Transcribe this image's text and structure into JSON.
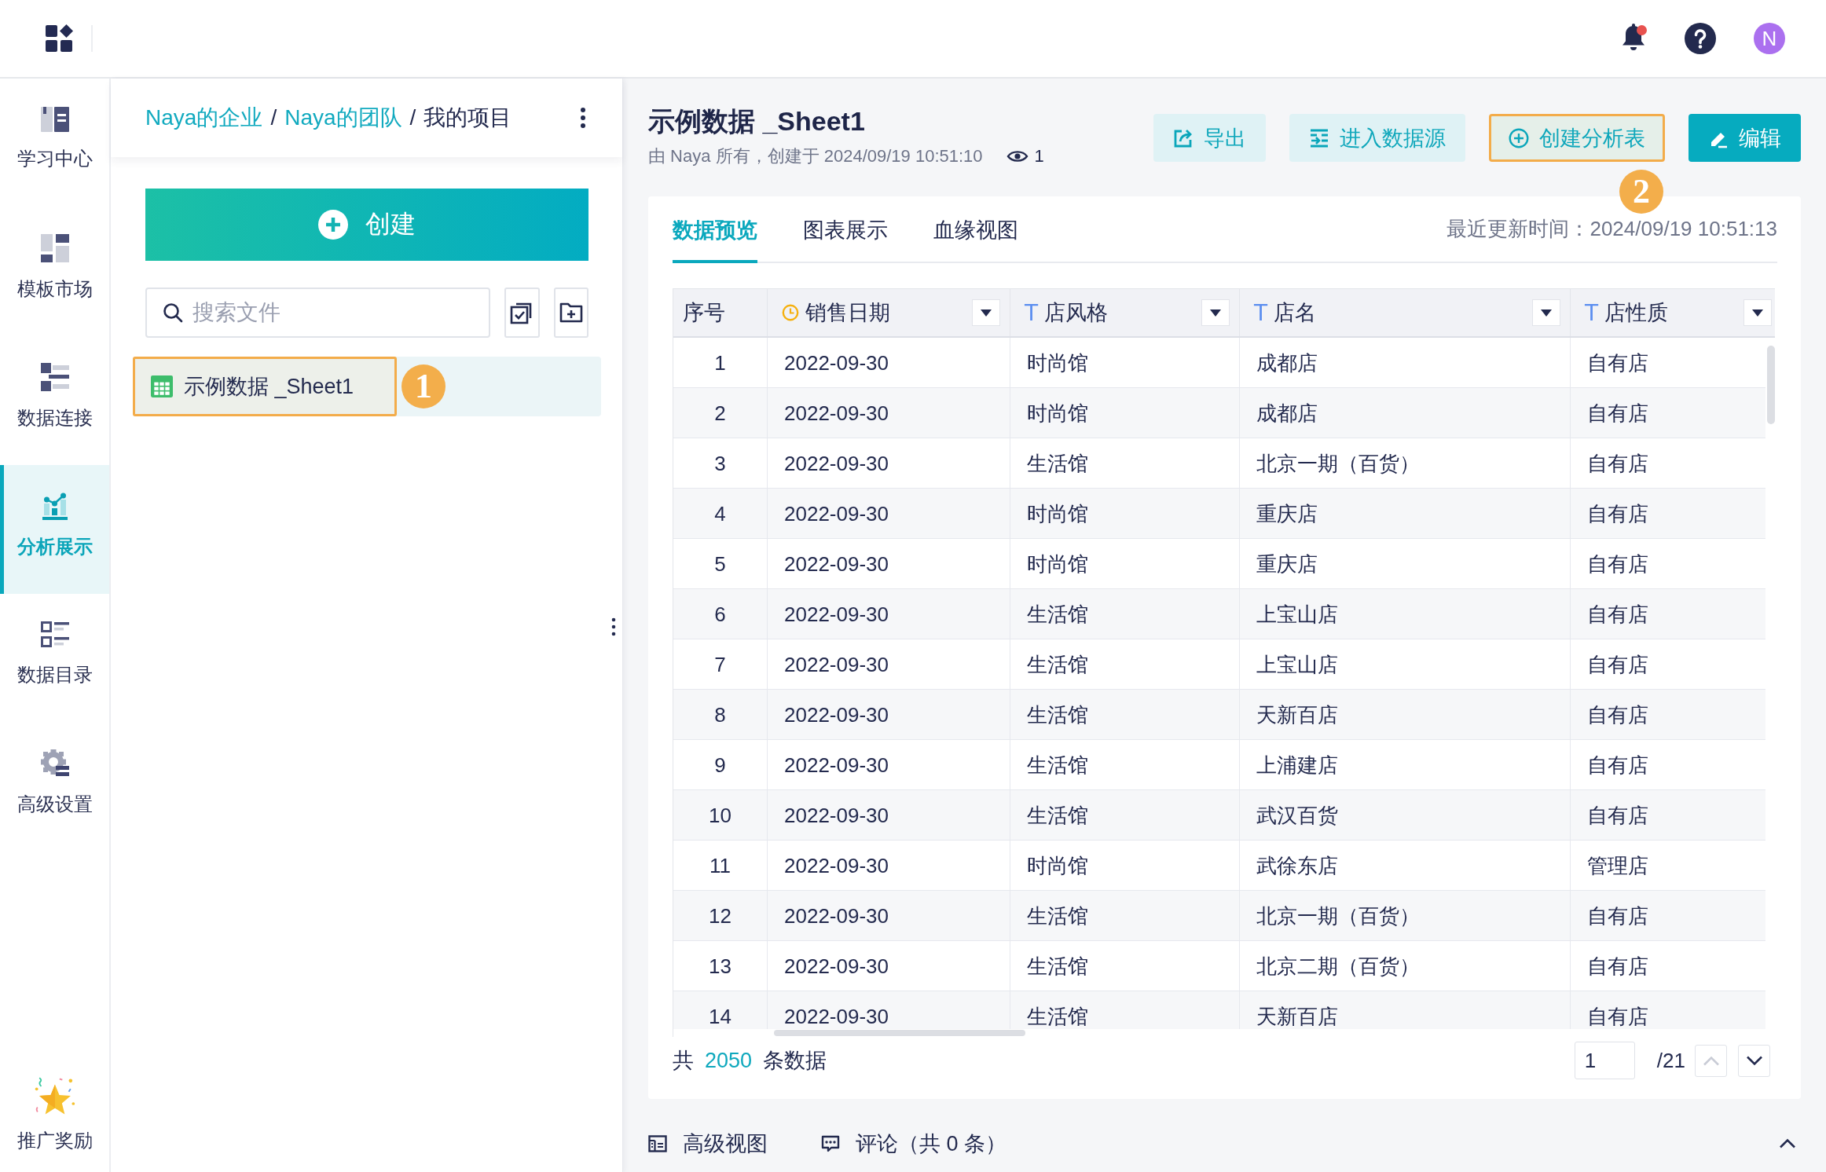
{
  "top_bar": {
    "notifications": {
      "unread": true
    },
    "avatar": {
      "initial": "N"
    }
  },
  "nav": {
    "items": [
      {
        "label": "学习中心",
        "kind": "learning",
        "selected": false
      },
      {
        "label": "模板市场",
        "kind": "templates",
        "selected": false
      },
      {
        "label": "数据连接",
        "kind": "connections",
        "selected": false
      },
      {
        "label": "分析展示",
        "kind": "analysis",
        "selected": true
      },
      {
        "label": "数据目录",
        "kind": "catalog",
        "selected": false
      },
      {
        "label": "高级设置",
        "kind": "settings",
        "selected": false
      }
    ],
    "footer_item": {
      "label": "推广奖励"
    }
  },
  "file_panel": {
    "breadcrumb": [
      {
        "label": "Naya的企业",
        "kind": "link"
      },
      {
        "label": "/",
        "kind": "separator"
      },
      {
        "label": "Naya的团队",
        "kind": "link"
      },
      {
        "label": "/",
        "kind": "separator"
      },
      {
        "label": "我的项目",
        "kind": "current"
      }
    ],
    "create_button": {
      "label": "创建"
    },
    "search": {
      "placeholder": "搜索文件"
    },
    "files": [
      {
        "label": "示例数据 _Sheet1",
        "selected": true,
        "highlighted": true,
        "step_badge": "1"
      }
    ]
  },
  "dataset": {
    "title": "示例数据 _Sheet1",
    "meta": "由 Naya 所有，创建于 2024/09/19 10:51:10",
    "views": "1",
    "actions": [
      {
        "label": "导出",
        "kind": "export",
        "highlighted": false
      },
      {
        "label": "进入数据源",
        "kind": "source",
        "highlighted": false
      },
      {
        "label": "创建分析表",
        "kind": "create",
        "highlighted": true,
        "step_badge": "2"
      },
      {
        "label": "编辑",
        "kind": "edit",
        "highlighted": false
      }
    ]
  },
  "tabs": {
    "items": [
      {
        "label": "数据预览",
        "selected": true
      },
      {
        "label": "图表展示",
        "selected": false
      },
      {
        "label": "血缘视图",
        "selected": false
      }
    ],
    "last_updated": "最近更新时间：2024/09/19 10:51:13"
  },
  "table": {
    "columns": [
      {
        "label": "序号",
        "kind": "index"
      },
      {
        "label": "销售日期",
        "kind": "date"
      },
      {
        "label": "店风格",
        "kind": "text",
        "type_mark": "T"
      },
      {
        "label": "店名",
        "kind": "text",
        "type_mark": "T"
      },
      {
        "label": "店性质",
        "kind": "text",
        "type_mark": "T"
      }
    ],
    "rows": [
      [
        "1",
        "2022-09-30",
        "时尚馆",
        "成都店",
        "自有店"
      ],
      [
        "2",
        "2022-09-30",
        "时尚馆",
        "成都店",
        "自有店"
      ],
      [
        "3",
        "2022-09-30",
        "生活馆",
        "北京一期（百货）",
        "自有店"
      ],
      [
        "4",
        "2022-09-30",
        "时尚馆",
        "重庆店",
        "自有店"
      ],
      [
        "5",
        "2022-09-30",
        "时尚馆",
        "重庆店",
        "自有店"
      ],
      [
        "6",
        "2022-09-30",
        "生活馆",
        "上宝山店",
        "自有店"
      ],
      [
        "7",
        "2022-09-30",
        "生活馆",
        "上宝山店",
        "自有店"
      ],
      [
        "8",
        "2022-09-30",
        "生活馆",
        "天新百店",
        "自有店"
      ],
      [
        "9",
        "2022-09-30",
        "生活馆",
        "上浦建店",
        "自有店"
      ],
      [
        "10",
        "2022-09-30",
        "生活馆",
        "武汉百货",
        "自有店"
      ],
      [
        "11",
        "2022-09-30",
        "时尚馆",
        "武徐东店",
        "管理店"
      ],
      [
        "12",
        "2022-09-30",
        "生活馆",
        "北京一期（百货）",
        "自有店"
      ],
      [
        "13",
        "2022-09-30",
        "生活馆",
        "北京二期（百货）",
        "自有店"
      ],
      [
        "14",
        "2022-09-30",
        "生活馆",
        "天新百店",
        "自有店"
      ]
    ],
    "summary": {
      "prefix": "共",
      "count": "2050",
      "suffix": "条数据"
    },
    "pagination": {
      "page": "1",
      "total": "/21",
      "prev": {
        "disabled": true
      },
      "next": {
        "disabled": false
      }
    }
  },
  "bottom_bar": {
    "items": [
      {
        "label": "高级视图",
        "kind": "view"
      },
      {
        "label": "评论（共 0 条）",
        "kind": "comments"
      }
    ],
    "expanded": false
  }
}
